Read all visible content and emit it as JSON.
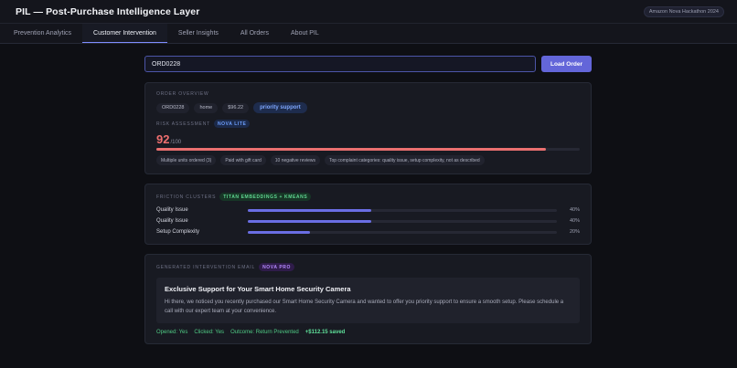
{
  "header": {
    "title": "PIL — Post-Purchase Intelligence Layer",
    "badge": "Amazon Nova Hackathon 2024"
  },
  "tabs": [
    {
      "label": "Prevention Analytics"
    },
    {
      "label": "Customer Intervention",
      "active": true
    },
    {
      "label": "Seller Insights"
    },
    {
      "label": "All Orders"
    },
    {
      "label": "About PIL"
    }
  ],
  "search": {
    "value": "ORD0228",
    "button_label": "Load Order"
  },
  "overview": {
    "label": "Order Overview",
    "chips": [
      "ORD0228",
      "home",
      "$96.22"
    ],
    "priority_chip": "priority support"
  },
  "risk": {
    "label": "Risk Assessment",
    "model_tag": "NOVA LITE",
    "score": "92",
    "denominator": "/100",
    "fraction": 0.92,
    "color": "#ea7070",
    "reasons": [
      "Multiple units ordered (3)",
      "Paid with gift card",
      "10 negative reviews",
      "Top complaint categories: quality issue, setup complexity, not as described"
    ]
  },
  "clusters": {
    "label": "Friction Clusters",
    "model_tag": "TITAN EMBEDDINGS + KMEANS",
    "items": [
      {
        "name": "Quality Issue",
        "pct": "40%",
        "fraction": 0.4
      },
      {
        "name": "Quality Issue",
        "pct": "40%",
        "fraction": 0.4
      },
      {
        "name": "Setup Complexity",
        "pct": "20%",
        "fraction": 0.2
      }
    ]
  },
  "email": {
    "label": "Generated Intervention Email",
    "model_tag": "NOVA PRO",
    "subject": "Exclusive Support for Your Smart Home Security Camera",
    "body": "Hi there, we noticed you recently purchased our Smart Home Security Camera and wanted to offer you priority support to ensure a smooth setup. Please schedule a call with our expert team at your convenience.",
    "opened": "Opened: Yes",
    "clicked": "Clicked: Yes",
    "outcome": "Outcome: Return Prevented",
    "saved": "+$112.15 saved"
  }
}
